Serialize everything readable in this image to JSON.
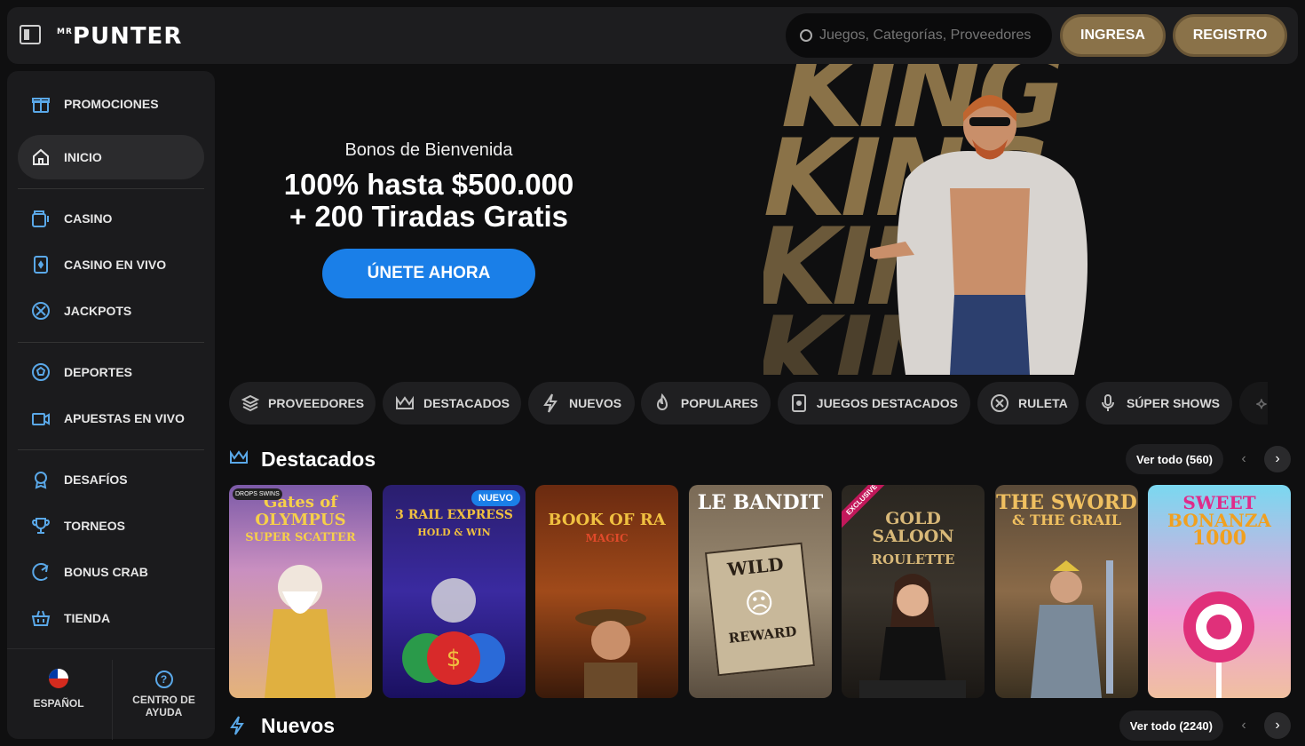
{
  "header": {
    "logo_small": "MR",
    "logo": "PUNTER",
    "search_placeholder": "Juegos, Categorías, Proveedores",
    "login_label": "INGRESA",
    "register_label": "REGISTRO"
  },
  "sidebar": {
    "items": [
      {
        "label": "PROMOCIONES",
        "icon": "gift-icon"
      },
      {
        "label": "INICIO",
        "icon": "home-icon"
      },
      {
        "label": "CASINO",
        "icon": "slot-machine-icon"
      },
      {
        "label": "CASINO EN VIVO",
        "icon": "card-icon"
      },
      {
        "label": "JACKPOTS",
        "icon": "jackpot-icon"
      },
      {
        "label": "DEPORTES",
        "icon": "soccer-ball-icon"
      },
      {
        "label": "APUESTAS EN VIVO",
        "icon": "live-video-icon"
      },
      {
        "label": "DESAFÍOS",
        "icon": "medal-icon"
      },
      {
        "label": "TORNEOS",
        "icon": "trophy-icon"
      },
      {
        "label": "BONUS CRAB",
        "icon": "crab-claw-icon"
      },
      {
        "label": "TIENDA",
        "icon": "basket-icon"
      }
    ],
    "language": "ESPAÑOL",
    "help_line1": "CENTRO DE",
    "help_line2": "AYUDA"
  },
  "hero": {
    "subtitle": "Bonos de Bienvenida",
    "title_line1": "100% hasta $500.000",
    "title_line2": "+ 200 Tiradas Gratis",
    "cta_label": "ÚNETE AHORA",
    "art_word": "KING"
  },
  "categories": [
    {
      "label": "PROVEEDORES",
      "icon": "layers-icon"
    },
    {
      "label": "DESTACADOS",
      "icon": "crown-icon"
    },
    {
      "label": "NUEVOS",
      "icon": "lightning-icon"
    },
    {
      "label": "POPULARES",
      "icon": "flame-icon"
    },
    {
      "label": "JUEGOS DESTACADOS",
      "icon": "card-icon"
    },
    {
      "label": "RULETA",
      "icon": "roulette-icon"
    },
    {
      "label": "SÚPER SHOWS",
      "icon": "microphone-icon"
    }
  ],
  "sections": {
    "featured": {
      "title": "Destacados",
      "view_all": "Ver todo (560)"
    },
    "new": {
      "title": "Nuevos",
      "view_all": "Ver todo (2240)"
    }
  },
  "games": [
    {
      "name": "Gates of OLYMPUS",
      "sub": "SUPER SCATTER",
      "corner": "DROPS SWINS"
    },
    {
      "name": "3 RAIL EXPRESS",
      "sub": "HOLD & WIN",
      "badge": "NUEVO"
    },
    {
      "name": "BOOK OF RA",
      "sub": "MAGIC"
    },
    {
      "name": "LE BANDIT",
      "sub": "WILD",
      "footer": "REWARD"
    },
    {
      "name": "GOLD SALOON",
      "sub": "ROULETTE",
      "ribbon": "EXCLUSIVE"
    },
    {
      "name": "THE SWORD",
      "sub": "& THE GRAIL"
    },
    {
      "name": "SWEET",
      "sub": "BONANZA",
      "footer": "1000"
    }
  ],
  "colors": {
    "accent_blue": "#1a7fe8",
    "gold": "#8a7249",
    "background": "#0f0f10",
    "panel": "#1b1b1d"
  }
}
